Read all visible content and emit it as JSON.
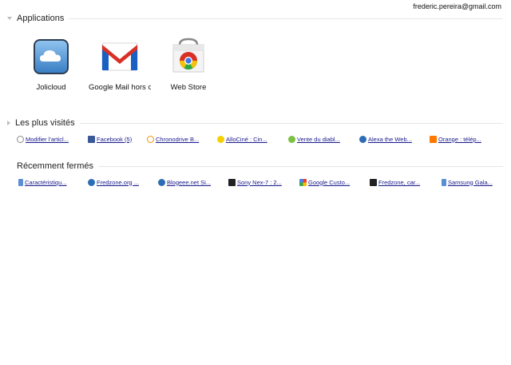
{
  "account": {
    "email": "frederic.pereira@gmail.com"
  },
  "sections": {
    "applications": {
      "title": "Applications"
    },
    "most_visited": {
      "title": "Les plus visités"
    },
    "recently_closed": {
      "title": "Récemment fermés"
    }
  },
  "apps": [
    {
      "name": "Jolicloud",
      "icon": "jolicloud-icon"
    },
    {
      "name": "Google Mail hors connexion",
      "icon": "gmail-icon"
    },
    {
      "name": "Web Store",
      "icon": "web-store-icon"
    }
  ],
  "most_visited": [
    {
      "label": "Modifier l'articl...",
      "icon": "wordpress-favicon",
      "color": "#8a8a8a"
    },
    {
      "label": "Facebook (5)",
      "icon": "facebook-favicon",
      "color": "#3b5998"
    },
    {
      "label": "Chronodrive B...",
      "icon": "chronodrive-favicon",
      "color": "#f29100"
    },
    {
      "label": "AlloCiné : Cin...",
      "icon": "allocine-favicon",
      "color": "#f5d000"
    },
    {
      "label": "Vente du diabl...",
      "icon": "vente-favicon",
      "color": "#7bc143"
    },
    {
      "label": "Alexa the Web...",
      "icon": "globe-favicon",
      "color": "#2d6db5"
    },
    {
      "label": "Orange : télép...",
      "icon": "orange-favicon",
      "color": "#ff7900"
    }
  ],
  "recently_closed": [
    {
      "label": "Caractéristiqu...",
      "icon": "page-favicon",
      "color": "#5a8fd6"
    },
    {
      "label": "Fredzone.org ...",
      "icon": "globe-favicon",
      "color": "#2d6db5"
    },
    {
      "label": "Blogeee.net Si...",
      "icon": "globe-favicon",
      "color": "#2d6db5"
    },
    {
      "label": "Sony Nex-7 : 2...",
      "icon": "fredzone-favicon",
      "color": "#222222"
    },
    {
      "label": "Google Custo...",
      "icon": "google-favicon",
      "color": "#4285f4"
    },
    {
      "label": "Fredzone, car...",
      "icon": "fredzone-favicon",
      "color": "#222222"
    },
    {
      "label": "Samsung Gala...",
      "icon": "page-favicon",
      "color": "#5a8fd6"
    }
  ]
}
